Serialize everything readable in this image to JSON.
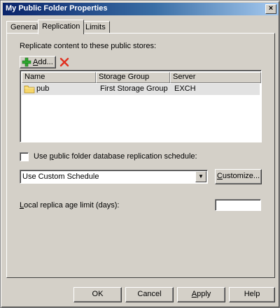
{
  "window": {
    "title": "My Public Folder Properties",
    "close_glyph": "×"
  },
  "tabs": [
    {
      "label": "General",
      "active": false
    },
    {
      "label": "Replication",
      "active": true
    },
    {
      "label": "Limits",
      "active": false
    }
  ],
  "replication": {
    "intro_label": "Replicate content to these public stores:",
    "add_button": {
      "accel": "A",
      "rest": "dd..."
    },
    "list": {
      "columns": [
        "Name",
        "Storage Group",
        "Server"
      ],
      "rows": [
        {
          "name": "pub",
          "storage_group": "First Storage Group",
          "server": "EXCH",
          "icon": "folder-icon"
        }
      ]
    },
    "schedule_checkbox": {
      "label_before": "Use ",
      "accel": "p",
      "label_after": "ublic folder database replication schedule:",
      "checked": false
    },
    "schedule_select": {
      "value": "Use Custom Schedule"
    },
    "customize_button": {
      "accel": "C",
      "rest": "ustomize..."
    },
    "age_limit": {
      "label_before": "",
      "accel": "L",
      "label_after": "ocal replica age limit (days):",
      "value": ""
    }
  },
  "footer": {
    "ok": "OK",
    "cancel": "Cancel",
    "apply_accel": "A",
    "apply_rest": "pply",
    "help": "Help"
  },
  "colors": {
    "delete_icon": "#e03020",
    "add_icon": "#2fa82f",
    "folder_icon": "#f6d66a"
  }
}
